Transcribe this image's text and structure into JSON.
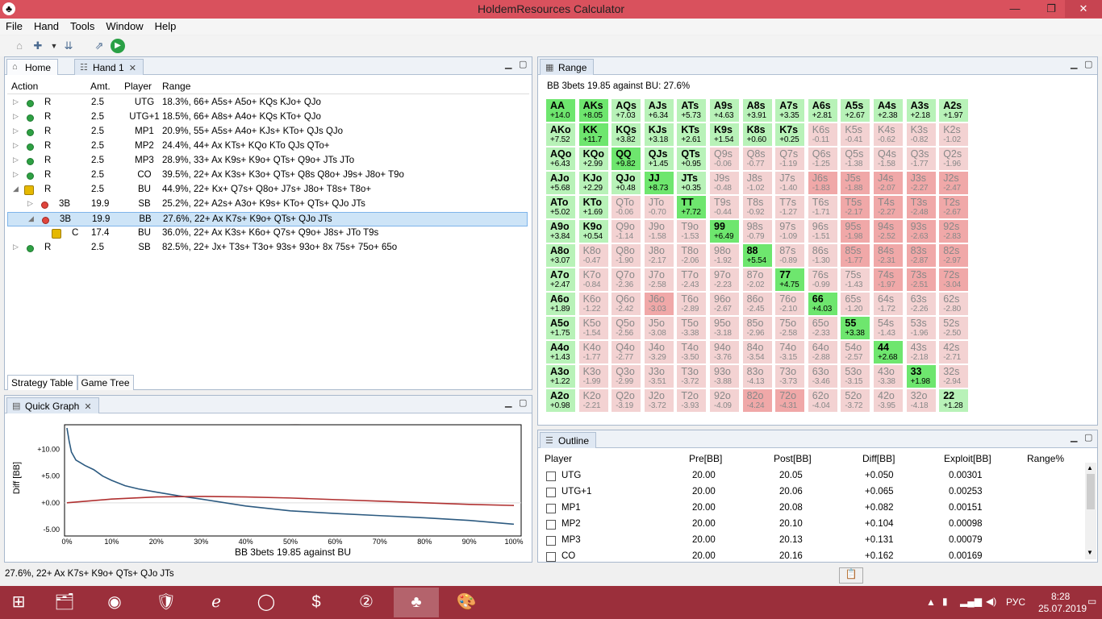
{
  "window": {
    "title": "HoldemResources Calculator",
    "min": "—",
    "max": "❐",
    "close": "✕"
  },
  "menu": [
    "File",
    "Hand",
    "Tools",
    "Window",
    "Help"
  ],
  "tabs_main": [
    {
      "label": "Home"
    },
    {
      "label": "Hand 1"
    }
  ],
  "strategy": {
    "headers": [
      "Action",
      "Amt.",
      "Player",
      "Range"
    ],
    "rows": [
      {
        "exp": "▷",
        "icon": "dot-green",
        "action": "R",
        "amt": "2.5",
        "player": "UTG",
        "range": "18.3%, 66+ A5s+ A5o+ KQs KJo+ QJo"
      },
      {
        "exp": "▷",
        "icon": "dot-green",
        "action": "R",
        "amt": "2.5",
        "player": "UTG+1",
        "range": "18.5%, 66+ A8s+ A4o+ KQs KTo+ QJo"
      },
      {
        "exp": "▷",
        "icon": "dot-green",
        "action": "R",
        "amt": "2.5",
        "player": "MP1",
        "range": "20.9%, 55+ A5s+ A4o+ KJs+ KTo+ QJs QJo"
      },
      {
        "exp": "▷",
        "icon": "dot-green",
        "action": "R",
        "amt": "2.5",
        "player": "MP2",
        "range": "24.4%, 44+ Ax KTs+ KQo KTo QJs QTo+"
      },
      {
        "exp": "▷",
        "icon": "dot-green",
        "action": "R",
        "amt": "2.5",
        "player": "MP3",
        "range": "28.9%, 33+ Ax K9s+ K9o+ QTs+ Q9o+ JTs JTo"
      },
      {
        "exp": "▷",
        "icon": "dot-green",
        "action": "R",
        "amt": "2.5",
        "player": "CO",
        "range": "39.5%, 22+ Ax K3s+ K3o+ QTs+ Q8s Q8o+ J9s+ J8o+ T9o"
      },
      {
        "exp": "◢",
        "icon": "lock",
        "action": "R",
        "amt": "2.5",
        "player": "BU",
        "range": "44.9%, 22+ Kx+ Q7s+ Q8o+ J7s+ J8o+ T8s+ T8o+"
      },
      {
        "exp": "▷",
        "icon": "dot-red",
        "action": "3B",
        "amt": "19.9",
        "player": "SB",
        "range": "25.2%, 22+ A2s+ A3o+ K9s+ KTo+ QTs+ QJo JTs"
      },
      {
        "exp": "◢",
        "icon": "dot-red",
        "action": "3B",
        "amt": "19.9",
        "player": "BB",
        "range": "27.6%, 22+ Ax K7s+ K9o+ QTs+ QJo JTs"
      },
      {
        "exp": "",
        "icon": "lock",
        "action": "C",
        "amt": "17.4",
        "player": "BU",
        "range": "36.0%, 22+ Ax K3s+ K6o+ Q7s+ Q9o+ J8s+ JTo T9s"
      },
      {
        "exp": "▷",
        "icon": "dot-green",
        "action": "R",
        "amt": "2.5",
        "player": "SB",
        "range": "82.5%, 22+ Jx+ T3s+ T3o+ 93s+ 93o+ 8x 75s+ 75o+ 65o"
      }
    ],
    "bottom_tabs": [
      "Strategy Table",
      "Game Tree"
    ]
  },
  "quickgraph": {
    "tab": "Quick Graph",
    "ylabel": "Diff [BB]",
    "xlabel": "BB 3bets 19.85 against BU",
    "yticks": [
      "+10.00",
      "+5.00",
      "+0.00",
      "-5.00"
    ],
    "xticks": [
      "0%",
      "10%",
      "20%",
      "30%",
      "40%",
      "50%",
      "60%",
      "70%",
      "80%",
      "90%",
      "100%"
    ]
  },
  "chart_data": {
    "type": "line",
    "title": "",
    "xlabel": "BB 3bets 19.85 against BU",
    "ylabel": "Diff [BB]",
    "xlim": [
      0,
      100
    ],
    "ylim": [
      -5,
      14
    ],
    "series": [
      {
        "color": "#2c5a80",
        "x": [
          0,
          0.5,
          1,
          2,
          3,
          4,
          6,
          8,
          10,
          13,
          16,
          20,
          25,
          30,
          40,
          50,
          60,
          70,
          80,
          90,
          100
        ],
        "y": [
          14,
          11.5,
          9.5,
          8,
          7.5,
          7,
          6.2,
          5,
          4.2,
          3.2,
          2.6,
          2,
          1.3,
          0.7,
          -0.6,
          -1.5,
          -2,
          -2.4,
          -2.8,
          -3.3,
          -4
        ]
      },
      {
        "color": "#b03030",
        "x": [
          0,
          10,
          20,
          30,
          40,
          50,
          60,
          70,
          80,
          90,
          100
        ],
        "y": [
          0,
          0.7,
          1.1,
          1.2,
          1.1,
          0.9,
          0.6,
          0.3,
          0,
          -0.3,
          -0.5
        ]
      }
    ]
  },
  "range": {
    "tab": "Range",
    "caption": "BB 3bets 19.85 against BU: 27.6%",
    "colors": {
      "raise_strong": "#6ee66e",
      "raise": "#b8f2b8",
      "fold_mild": "#f3d2d2",
      "fold": "#f0a8a8"
    }
  },
  "range_grid": [
    [
      "AA|+14.0|3",
      "AKs|+8.05|3",
      "AQs|+7.03|2",
      "AJs|+6.34|2",
      "ATs|+5.73|2",
      "A9s|+4.63|2",
      "A8s|+3.91|2",
      "A7s|+3.35|2",
      "A6s|+2.81|2",
      "A5s|+2.67|2",
      "A4s|+2.38|2",
      "A3s|+2.18|2",
      "A2s|+1.97|2"
    ],
    [
      "AKo|+7.52|2",
      "KK|+11.7|3",
      "KQs|+3.82|2",
      "KJs|+3.18|2",
      "KTs|+2.61|2",
      "K9s|+1.54|2",
      "K8s|+0.60|2",
      "K7s|+0.25|2",
      "K6s|-0.11|0",
      "K5s|-0.41|0",
      "K4s|-0.62|0",
      "K3s|-0.82|0",
      "K2s|-1.02|0"
    ],
    [
      "AQo|+6.43|2",
      "KQo|+2.99|2",
      "QQ|+9.82|3",
      "QJs|+1.45|2",
      "QTs|+0.95|2",
      "Q9s|-0.06|0",
      "Q8s|-0.77|0",
      "Q7s|-1.19|0",
      "Q6s|-1.25|0",
      "Q5s|-1.38|0",
      "Q4s|-1.58|0",
      "Q3s|-1.77|0",
      "Q2s|-1.96|0"
    ],
    [
      "AJo|+5.68|2",
      "KJo|+2.29|2",
      "QJo|+0.48|2",
      "JJ|+8.73|3",
      "JTs|+0.35|2",
      "J9s|-0.48|0",
      "J8s|-1.02|0",
      "J7s|-1.40|0",
      "J6s|-1.83|1",
      "J5s|-1.88|1",
      "J4s|-2.07|1",
      "J3s|-2.27|1",
      "J2s|-2.47|1"
    ],
    [
      "ATo|+5.02|2",
      "KTo|+1.69|2",
      "QTo|-0.06|0",
      "JTo|-0.70|0",
      "TT|+7.72|3",
      "T9s|-0.44|0",
      "T8s|-0.92|0",
      "T7s|-1.27|0",
      "T6s|-1.71|0",
      "T5s|-2.17|1",
      "T4s|-2.27|1",
      "T3s|-2.48|1",
      "T2s|-2.67|1"
    ],
    [
      "A9o|+3.84|2",
      "K9o|+0.54|2",
      "Q9o|-1.14|0",
      "J9o|-1.58|0",
      "T9o|-1.53|0",
      "99|+6.49|3",
      "98s|-0.79|0",
      "97s|-1.09|0",
      "96s|-1.51|0",
      "95s|-1.98|1",
      "94s|-2.52|1",
      "93s|-2.63|1",
      "92s|-2.83|1"
    ],
    [
      "A8o|+3.07|2",
      "K8o|-0.47|0",
      "Q8o|-1.90|0",
      "J8o|-2.17|0",
      "T8o|-2.06|0",
      "98o|-1.92|0",
      "88|+5.54|3",
      "87s|-0.89|0",
      "86s|-1.30|0",
      "85s|-1.77|1",
      "84s|-2.31|1",
      "83s|-2.87|1",
      "82s|-2.97|1"
    ],
    [
      "A7o|+2.47|2",
      "K7o|-0.84|0",
      "Q7o|-2.36|0",
      "J7o|-2.58|0",
      "T7o|-2.43|0",
      "97o|-2.23|0",
      "87o|-2.02|0",
      "77|+4.75|3",
      "76s|-0.99|0",
      "75s|-1.43|0",
      "74s|-1.97|1",
      "73s|-2.51|1",
      "72s|-3.04|1"
    ],
    [
      "A6o|+1.89|2",
      "K6o|-1.22|0",
      "Q6o|-2.42|0",
      "J6o|-3.03|1",
      "T6o|-2.89|0",
      "96o|-2.67|0",
      "86o|-2.45|0",
      "76o|-2.10|0",
      "66|+4.03|3",
      "65s|-1.20|0",
      "64s|-1.72|0",
      "63s|-2.26|0",
      "62s|-2.80|0"
    ],
    [
      "A5o|+1.75|2",
      "K5o|-1.54|0",
      "Q5o|-2.56|0",
      "J5o|-3.08|0",
      "T5o|-3.38|0",
      "95o|-3.18|0",
      "85o|-2.96|0",
      "75o|-2.58|0",
      "65o|-2.33|0",
      "55|+3.38|3",
      "54s|-1.43|0",
      "53s|-1.96|0",
      "52s|-2.50|0"
    ],
    [
      "A4o|+1.43|2",
      "K4o|-1.77|0",
      "Q4o|-2.77|0",
      "J4o|-3.29|0",
      "T4o|-3.50|0",
      "94o|-3.76|0",
      "84o|-3.54|0",
      "74o|-3.15|0",
      "64o|-2.88|0",
      "54o|-2.57|0",
      "44|+2.68|3",
      "43s|-2.18|0",
      "42s|-2.71|0"
    ],
    [
      "A3o|+1.22|2",
      "K3o|-1.99|0",
      "Q3o|-2.99|0",
      "J3o|-3.51|0",
      "T3o|-3.72|0",
      "93o|-3.88|0",
      "83o|-4.13|0",
      "73o|-3.73|0",
      "63o|-3.46|0",
      "53o|-3.15|0",
      "43o|-3.38|0",
      "33|+1.98|3",
      "32s|-2.94|0"
    ],
    [
      "A2o|+0.98|2",
      "K2o|-2.21|0",
      "Q2o|-3.19|0",
      "J2o|-3.72|0",
      "T2o|-3.93|0",
      "92o|-4.09|0",
      "82o|-4.24|1",
      "72o|-4.31|1",
      "62o|-4.04|0",
      "52o|-3.72|0",
      "42o|-3.95|0",
      "32o|-4.18|0",
      "22|+1.28|2"
    ]
  ],
  "outline": {
    "tab": "Outline",
    "headers": [
      "Player",
      "Pre[BB]",
      "Post[BB]",
      "Diff[BB]",
      "Exploit[BB]",
      "Range%"
    ],
    "rows": [
      {
        "player": "UTG",
        "pre": "20.00",
        "post": "20.05",
        "diff": "+0.050",
        "exploit": "0.00301"
      },
      {
        "player": "UTG+1",
        "pre": "20.00",
        "post": "20.06",
        "diff": "+0.065",
        "exploit": "0.00253"
      },
      {
        "player": "MP1",
        "pre": "20.00",
        "post": "20.08",
        "diff": "+0.082",
        "exploit": "0.00151"
      },
      {
        "player": "MP2",
        "pre": "20.00",
        "post": "20.10",
        "diff": "+0.104",
        "exploit": "0.00098"
      },
      {
        "player": "MP3",
        "pre": "20.00",
        "post": "20.13",
        "diff": "+0.131",
        "exploit": "0.00079"
      },
      {
        "player": "CO",
        "pre": "20.00",
        "post": "20.16",
        "diff": "+0.162",
        "exploit": "0.00169"
      }
    ]
  },
  "status": {
    "text": "27.6%, 22+ Ax K7s+ K9o+ QTs+ QJo JTs"
  },
  "taskbar": {
    "lang": "РУС",
    "time": "8:28",
    "date": "25.07.2019"
  }
}
